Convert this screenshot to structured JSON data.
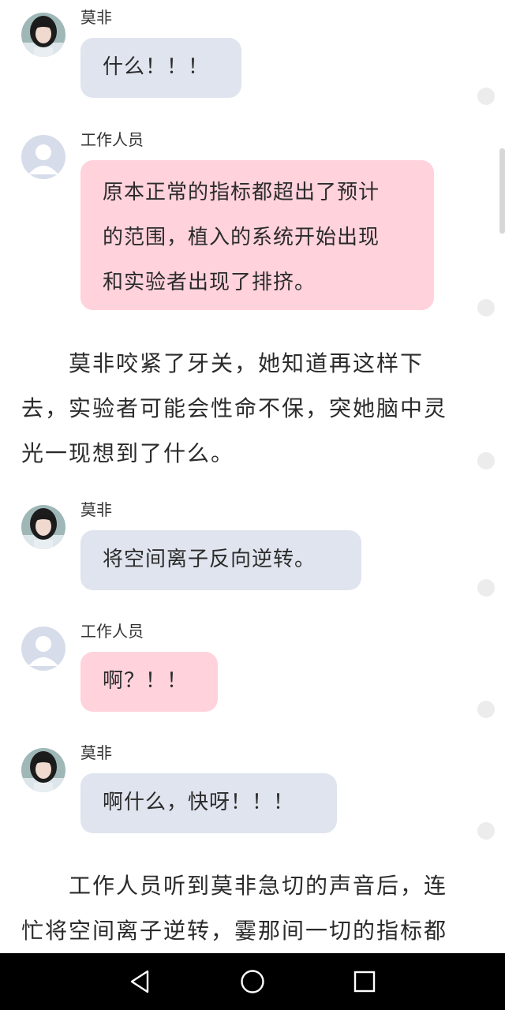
{
  "messages": [
    {
      "speaker": "莫非",
      "text": "什么！！！"
    },
    {
      "speaker": "工作人员",
      "lines": [
        "原本正常的指标都超出了预计",
        "的范围，植入的系统开始出现",
        "和实验者出现了排挤。"
      ]
    },
    {
      "speaker": "莫非",
      "text": "将空间离子反向逆转。"
    },
    {
      "speaker": "工作人员",
      "text": "啊？！！"
    },
    {
      "speaker": "莫非",
      "text": "啊什么，快呀！！！"
    }
  ],
  "narration": [
    {
      "lines": [
        "莫非咬紧了牙关，她知道再这样下",
        "去，实验者可能会性命不保，突她脑中灵",
        "光一现想到了什么。"
      ]
    },
    {
      "lines": [
        "工作人员听到莫非急切的声音后，连",
        "忙将空间离子逆转，霎那间一切的指标都"
      ]
    }
  ],
  "colors": {
    "bubble_gray": "#dfe4ee",
    "bubble_pink": "#ffd2dc",
    "nav_background": "#000000"
  },
  "navbar": {
    "back": "back-triangle-icon",
    "home": "home-circle-icon",
    "recents": "recents-square-icon"
  }
}
